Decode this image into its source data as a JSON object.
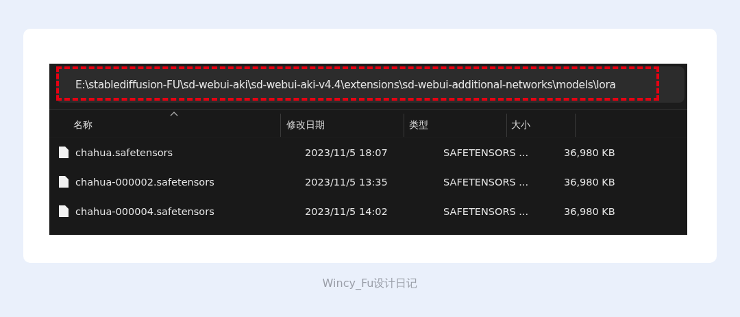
{
  "address_bar": {
    "path": "E:\\stablediffusion-FU\\sd-webui-aki\\sd-webui-aki-v4.4\\extensions\\sd-webui-additional-networks\\models\\lora",
    "highlighted": true
  },
  "table": {
    "columns": [
      {
        "label": "名称",
        "sorted": true
      },
      {
        "label": "修改日期",
        "sorted": false
      },
      {
        "label": "类型",
        "sorted": false
      },
      {
        "label": "大小",
        "sorted": false
      }
    ],
    "rows": [
      {
        "name": "chahua.safetensors",
        "date": "2023/11/5 18:07",
        "type": "SAFETENSORS ...",
        "size": "36,980 KB"
      },
      {
        "name": "chahua-000002.safetensors",
        "date": "2023/11/5 13:35",
        "type": "SAFETENSORS ...",
        "size": "36,980 KB"
      },
      {
        "name": "chahua-000004.safetensors",
        "date": "2023/11/5 14:02",
        "type": "SAFETENSORS ...",
        "size": "36,980 KB"
      }
    ]
  },
  "caption": "Wincy_Fu设计日记"
}
